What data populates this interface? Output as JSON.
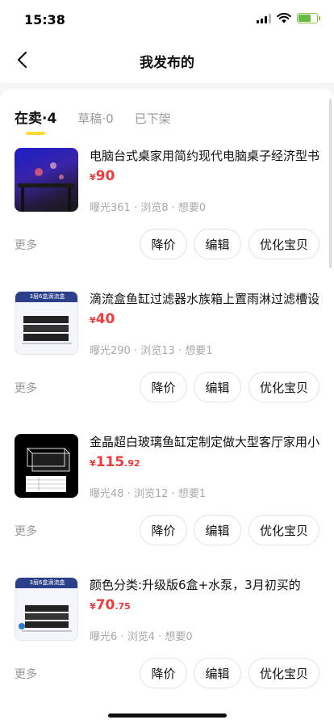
{
  "status": {
    "time": "15:38"
  },
  "nav": {
    "title": "我发布的"
  },
  "tabs": [
    {
      "label": "在卖",
      "count": "·4"
    },
    {
      "label": "草稿",
      "count": "·0"
    },
    {
      "label": "已下架",
      "count": ""
    }
  ],
  "currency_symbol": "¥",
  "actions": {
    "more": "更多",
    "reduce_price": "降价",
    "edit": "编辑",
    "optimize": "优化宝贝"
  },
  "items": [
    {
      "title": "电脑台式桌家用简约现代电脑桌子经济型书",
      "price_int": "90",
      "price_dec": "",
      "exposure": "曝光361",
      "views": "浏览8",
      "wants": "想要0",
      "thumb_label": ""
    },
    {
      "title": "滴流盒鱼缸过滤器水族箱上置雨淋过滤槽设",
      "price_int": "40",
      "price_dec": "",
      "exposure": "曝光290",
      "views": "浏览13",
      "wants": "想要1",
      "thumb_label": "3层6盒滴流盒"
    },
    {
      "title": "金晶超白玻璃鱼缸定制定做大型客厅家用小",
      "price_int": "115",
      "price_dec": ".92",
      "exposure": "曝光48",
      "views": "浏览12",
      "wants": "想要1",
      "thumb_label": ""
    },
    {
      "title": "颜色分类:升级版6盒+水泵，3月初买的",
      "price_int": "70",
      "price_dec": ".75",
      "exposure": "曝光6",
      "views": "浏览4",
      "wants": "想要0",
      "thumb_label": "3层6盒滴流盒"
    }
  ],
  "icons": {
    "back": "chevron-left-icon",
    "signal": "signal-icon",
    "wifi": "wifi-icon",
    "battery": "battery-charging-icon"
  },
  "colors": {
    "price": "#ef3b3b",
    "tab_underline": "#ffd83b",
    "battery": "#66bb44"
  }
}
